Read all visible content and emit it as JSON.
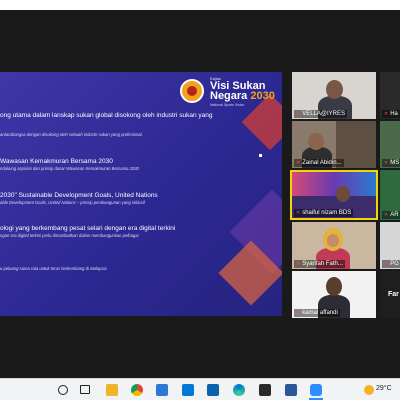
{
  "slide": {
    "logo": {
      "small_text": "Kajian",
      "title_line1": "Visi Sukan",
      "title_line2": "Negara",
      "year": "2030",
      "subtitle": "National Sports Vision"
    },
    "bullets": [
      {
        "heading": "ong utama dalam lanskap sukan global disokong oleh industri sukan yang",
        "detail": "antarabangsa dengan disokong oleh sebuah industri sukan yang profesional."
      },
      {
        "heading": "Wawasan Kemakmuran Bersama 2030",
        "detail": "ndukung aspirasi dan prinsip dasar Wawasan Kemakmuran Bersama 2030"
      },
      {
        "heading": "2030\" Sustainable Development Goals, United Nations",
        "detail": "able Development Goals, United Nations – prinsip pembangunan yang inklusif"
      },
      {
        "heading": "ologi yang berkembang pesat selari dengan era digital terkini",
        "detail": "ngan era digital terkini perlu dimanfaatkan dalam membangunkan pelbagai"
      },
      {
        "heading": "",
        "detail": "u peluang sama rata untuk terus berkembang di Malaysia"
      }
    ]
  },
  "participants": [
    {
      "name": "VELLA@IYRES"
    },
    {
      "name": "Ha"
    },
    {
      "name": "Zainal Abidin..."
    },
    {
      "name": "MS"
    },
    {
      "name": "shaiful nizam BDS"
    },
    {
      "name": "AR"
    },
    {
      "name": "Syarifah Fath..."
    },
    {
      "name": "PG"
    },
    {
      "name": "kamal affandi"
    },
    {
      "name": "Far"
    }
  ],
  "taskbar": {
    "weather": "29°C"
  },
  "colors": {
    "slide_bg": "#2c2892",
    "accent_orange": "#f2a21d",
    "accent_red": "#c83c3c"
  }
}
